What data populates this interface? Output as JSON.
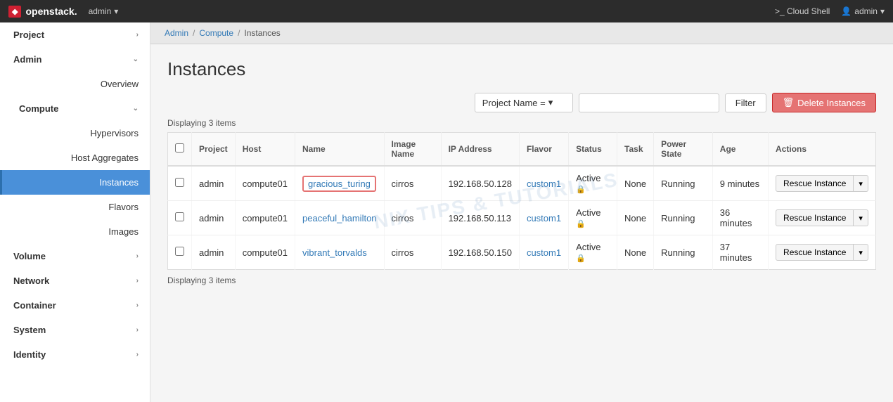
{
  "navbar": {
    "brand_logo": "◆",
    "brand_name": "openstack.",
    "project_label": "admin",
    "cloud_shell_label": ">_ Cloud Shell",
    "user_label": "admin"
  },
  "breadcrumb": {
    "items": [
      "Admin",
      "Compute",
      "Instances"
    ]
  },
  "page": {
    "title": "Instances"
  },
  "toolbar": {
    "filter_select": "Project Name =",
    "filter_placeholder": "",
    "filter_button": "Filter",
    "delete_button": "Delete Instances"
  },
  "table": {
    "display_top": "Displaying 3 items",
    "display_bottom": "Displaying 3 items",
    "columns": [
      "",
      "Project",
      "Host",
      "Name",
      "Image Name",
      "IP Address",
      "Flavor",
      "Status",
      "Task",
      "Power State",
      "Age",
      "Actions"
    ],
    "rows": [
      {
        "project": "admin",
        "host": "compute01",
        "name": "gracious_turing",
        "image_name": "cirros",
        "ip_address": "192.168.50.128",
        "flavor": "custom1",
        "status": "Active",
        "task": "None",
        "power_state": "Running",
        "age": "9 minutes",
        "action": "Rescue Instance",
        "highlighted": true
      },
      {
        "project": "admin",
        "host": "compute01",
        "name": "peaceful_hamilton",
        "image_name": "cirros",
        "ip_address": "192.168.50.113",
        "flavor": "custom1",
        "status": "Active",
        "task": "None",
        "power_state": "Running",
        "age": "36 minutes",
        "action": "Rescue Instance",
        "highlighted": false
      },
      {
        "project": "admin",
        "host": "compute01",
        "name": "vibrant_torvalds",
        "image_name": "cirros",
        "ip_address": "192.168.50.150",
        "flavor": "custom1",
        "status": "Active",
        "task": "None",
        "power_state": "Running",
        "age": "37 minutes",
        "action": "Rescue Instance",
        "highlighted": false
      }
    ]
  },
  "sidebar": {
    "items": [
      {
        "label": "Project",
        "type": "top",
        "expand": true
      },
      {
        "label": "Admin",
        "type": "top",
        "expand": true
      },
      {
        "label": "Overview",
        "type": "sub"
      },
      {
        "label": "Compute",
        "type": "section",
        "expand": true
      },
      {
        "label": "Hypervisors",
        "type": "sub"
      },
      {
        "label": "Host Aggregates",
        "type": "sub"
      },
      {
        "label": "Instances",
        "type": "sub",
        "active": true
      },
      {
        "label": "Flavors",
        "type": "sub"
      },
      {
        "label": "Images",
        "type": "sub"
      },
      {
        "label": "Volume",
        "type": "top",
        "expand": true
      },
      {
        "label": "Network",
        "type": "top",
        "expand": false
      },
      {
        "label": "Container",
        "type": "top",
        "expand": true
      },
      {
        "label": "System",
        "type": "top",
        "expand": true
      },
      {
        "label": "Identity",
        "type": "top",
        "expand": true
      }
    ]
  },
  "watermark": "NIX TIPS & TUTORIALS"
}
